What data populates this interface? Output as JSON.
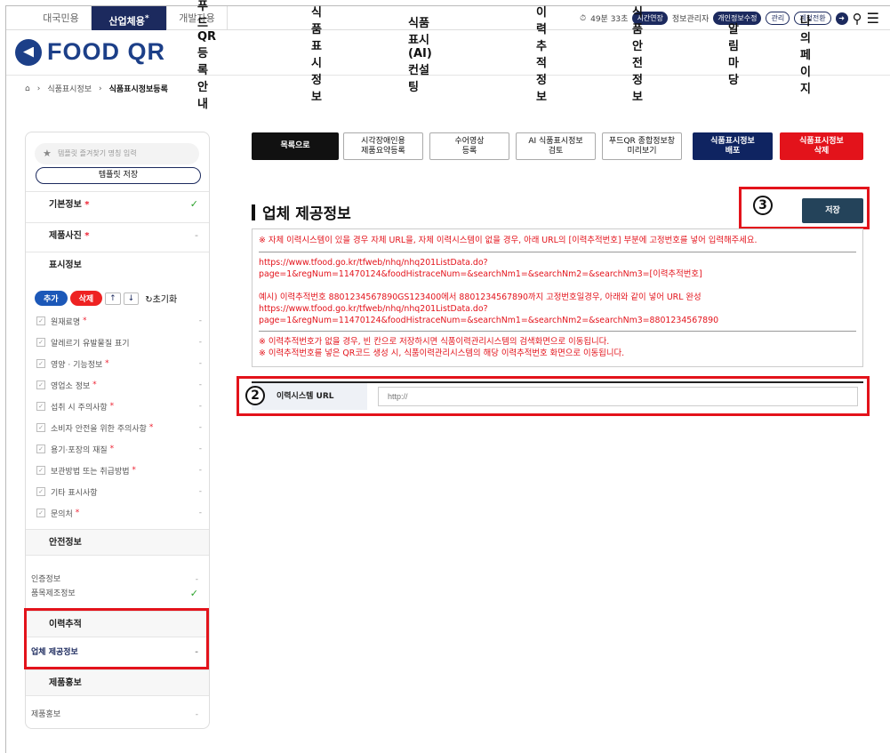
{
  "topbar": {
    "tabs": [
      "대국민용",
      "산업체용",
      "개발자용"
    ],
    "active_tab_suffix": "*",
    "timer": "49분 33초",
    "extend": "시간연장",
    "manager": "정보관리자",
    "edit_info": "개인정보수정",
    "admin": "관리",
    "switch": "계정전환"
  },
  "gnb": {
    "logo": "FOOD QR",
    "menu": [
      "푸드QR등록안내",
      "식품표시정보",
      "식품표시(AI)컨설팅",
      "이력추적정보",
      "식품안전정보",
      "알림마당",
      "나의페이지"
    ]
  },
  "breadcrumb": [
    "식품표시정보",
    "식품표시정보등록"
  ],
  "sidebar": {
    "template_search_placeholder": "템플릿 즐겨찾기 명칭 입력",
    "template_save": "템플릿 저장",
    "basic_info": "기본정보",
    "product_photo": "제품사진",
    "label_info_header": "표시정보",
    "controls": {
      "add": "추가",
      "delete": "삭제",
      "up": "↑",
      "down": "↓",
      "reset": "초기화"
    },
    "label_items": [
      {
        "label": "원재료명",
        "req": "*"
      },
      {
        "label": "알레르기 유발물질 표기",
        "req": ""
      },
      {
        "label": "영양 · 기능정보",
        "req": "*"
      },
      {
        "label": "영업소 정보",
        "req": "*"
      },
      {
        "label": "섭취 시 주의사항",
        "req": "*"
      },
      {
        "label": "소비자 안전을 위한 주의사항",
        "req": "*"
      },
      {
        "label": "용기·포장의 재질",
        "req": "*"
      },
      {
        "label": "보관방법 또는 취급방법",
        "req": "*"
      },
      {
        "label": "기타 표시사항",
        "req": ""
      },
      {
        "label": "문의처",
        "req": "*"
      }
    ],
    "safety_header": "안전정보",
    "cert_info": "인증정보",
    "mfg_info": "품목제조정보",
    "trace_header": "이력추적",
    "company_info": "업체 제공정보",
    "promo_header": "제품홍보",
    "promo_item": "제품홍보",
    "dash": "-"
  },
  "toolbar": {
    "list": "목록으로",
    "visual_summary": [
      "시각장애인용",
      "제품요약등록"
    ],
    "sign_video": [
      "수어영상",
      "등록"
    ],
    "ai_review": [
      "AI 식품표시정보",
      "검토"
    ],
    "preview": [
      "푸드QR 종합정보창",
      "미리보기"
    ],
    "deploy": [
      "식품표시정보",
      "배포"
    ],
    "delete": [
      "식품표시정보",
      "삭제"
    ]
  },
  "main": {
    "title": "업체 제공정보",
    "save": "저장",
    "notes": [
      "※ 자체 이력시스템이 있을 경우 자체 URL을, 자체 이력시스템이 없을 경우, 아래 URL의 [이력추적번호] 부분에 고정번호를 넣어 입력해주세요.",
      "https://www.tfood.go.kr/tfweb/nhq/nhq201ListData.do?",
      "page=1&regNum=11470124&foodHistraceNum=&searchNm1=&searchNm2=&searchNm3=[이력추적번호]",
      "예시) 이력추적번호 8801234567890GS123400에서 8801234567890까지 고정번호일경우, 아래와 같이 넣어 URL 완성",
      "https://www.tfood.go.kr/tfweb/nhq/nhq201ListData.do?",
      "page=1&regNum=11470124&foodHistraceNum=&searchNm1=&searchNm2=&searchNm3=8801234567890",
      "※ 이력추적번호가 없을 경우, 빈 칸으로 저장하시면 식품이력관리시스템의 검색화면으로 이동됩니다.",
      "※ 이력추적번호를 넣은 QR코드 생성 시, 식품이력관리시스템의 해당 이력추적번호 화면으로 이동됩니다."
    ],
    "url_label": "이력시스템 URL",
    "url_placeholder": "http://",
    "url_value": ""
  },
  "annotations": {
    "n2": "2",
    "n3": "3"
  },
  "colors": {
    "navy": "#1c2a5e",
    "red": "#e3131b",
    "logo": "#1c3f88"
  }
}
